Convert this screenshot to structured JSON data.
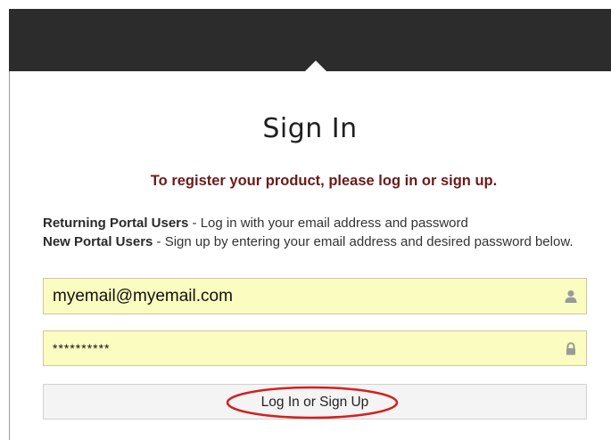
{
  "header": {
    "background": "#2d2c2d"
  },
  "title": "Sign In",
  "register_message": "To register your product, please log in or sign up.",
  "instructions": {
    "returning_label": "Returning Portal Users",
    "returning_text": " - Log in with your email address and password",
    "new_label": "New Portal Users",
    "new_text": " - Sign up by entering your email address and desired password below."
  },
  "form": {
    "email_value": "myemail@myemail.com",
    "email_icon": "user-icon",
    "password_value": "**********",
    "password_icon": "lock-icon",
    "field_background": "#fafcc0",
    "submit_label": "Log In or Sign Up"
  },
  "annotation": {
    "color": "#d42020"
  }
}
